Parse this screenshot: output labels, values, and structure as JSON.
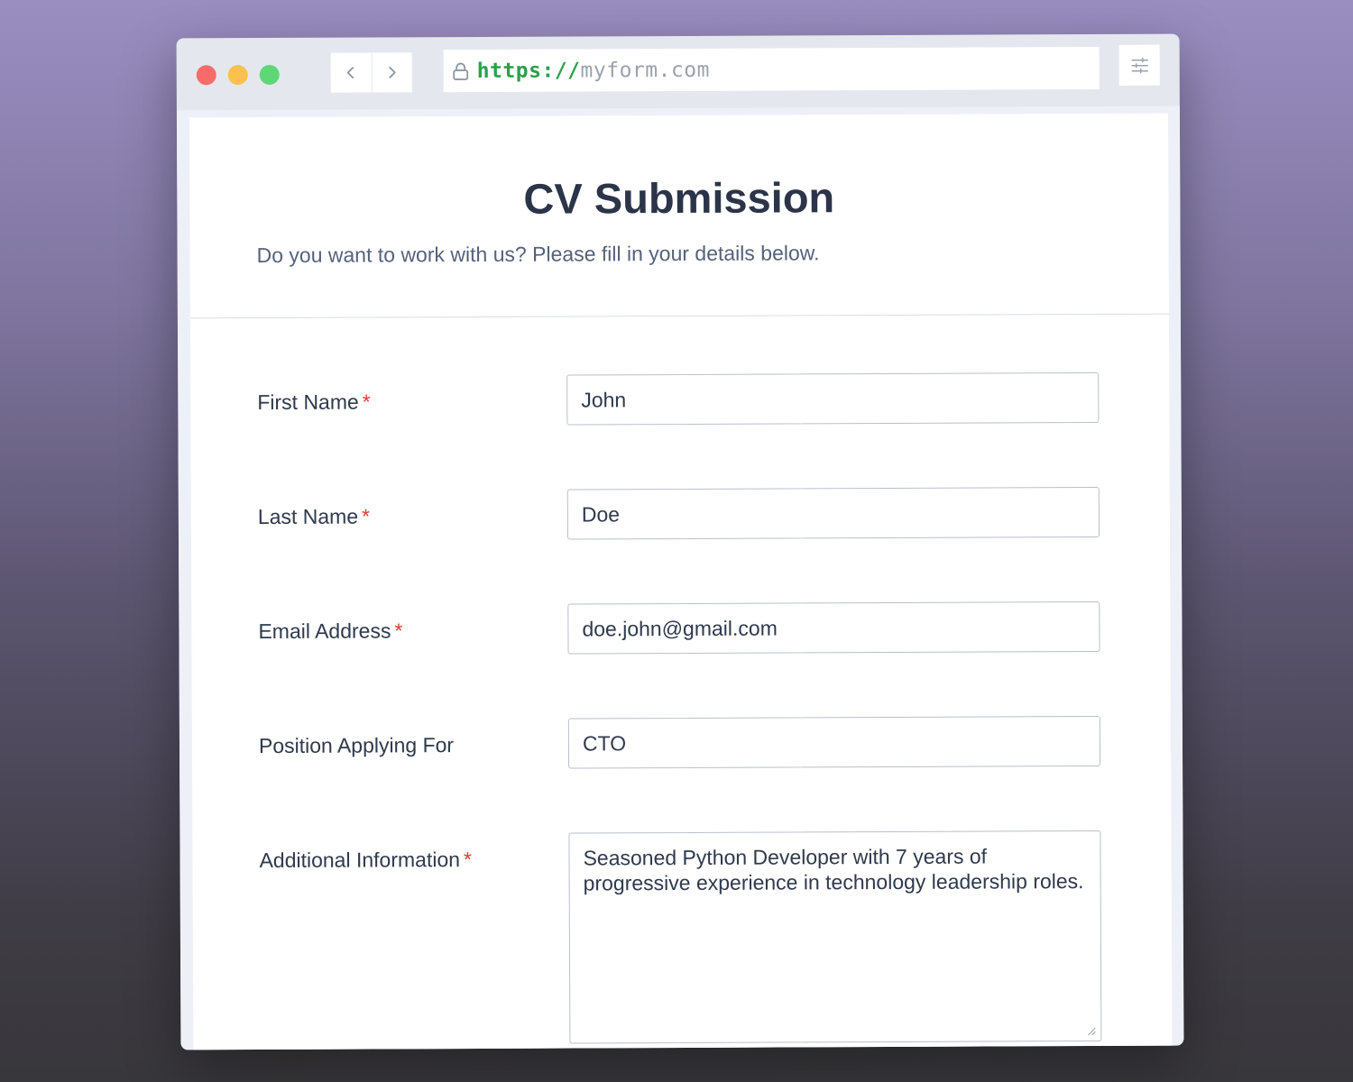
{
  "browser": {
    "url_scheme": "https://",
    "url_host": "myform.com",
    "back_label": "‹",
    "forward_label": "›",
    "colors": {
      "dot_red": "#f96b6b",
      "dot_yellow": "#fbc04e",
      "dot_green": "#5fd776",
      "scheme": "#2aa14a",
      "host": "#9aa2ad"
    }
  },
  "form": {
    "title": "CV Submission",
    "subtitle": "Do you want to work with us? Please fill in your details below.",
    "required_marker": "*",
    "fields": [
      {
        "label": "First Name",
        "value": "John",
        "required": true
      },
      {
        "label": "Last Name",
        "value": "Doe",
        "required": true
      },
      {
        "label": "Email Address",
        "value": "doe.john@gmail.com",
        "required": true
      },
      {
        "label": "Position Applying For",
        "value": "CTO",
        "required": false
      },
      {
        "label": "Additional Information",
        "value": "Seasoned Python Developer with 7 years of progressive experience in technology leadership roles.",
        "required": true
      }
    ]
  }
}
